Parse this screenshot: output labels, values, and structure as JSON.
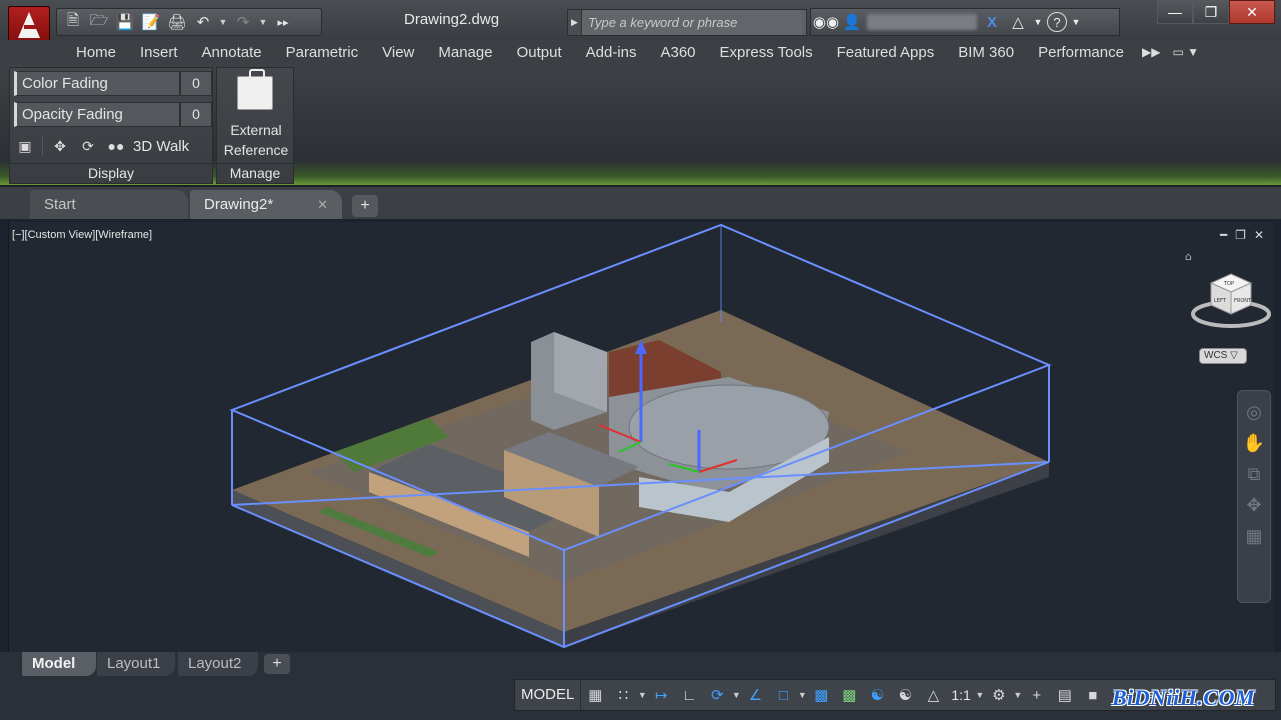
{
  "titlebar": {
    "doc_title": "Drawing2.dwg",
    "search_placeholder": "Type a keyword or phrase",
    "icons": [
      "new-icon",
      "open-icon",
      "save-icon",
      "saveas-icon",
      "plot-icon",
      "undo-icon",
      "redo-icon",
      "more-icon",
      "binoculars-icon",
      "user-icon",
      "exchange-icon",
      "a360-icon",
      "help-icon"
    ]
  },
  "ribbon_tabs": [
    "Home",
    "Insert",
    "Annotate",
    "Parametric",
    "View",
    "Manage",
    "Output",
    "Add-ins",
    "A360",
    "Express Tools",
    "Featured Apps",
    "BIM 360",
    "Performance"
  ],
  "ribbon": {
    "display": {
      "color_fading_label": "Color Fading",
      "color_fading_value": "0",
      "opacity_fading_label": "Opacity Fading",
      "opacity_fading_value": "0",
      "walk_label": "3D Walk",
      "title": "Display"
    },
    "manage": {
      "xref_line1": "External",
      "xref_line2": "Reference",
      "title": "Manage"
    }
  },
  "file_tabs": {
    "start": "Start",
    "drawing": "Drawing2*",
    "add": "+"
  },
  "viewport": {
    "label": "[−][Custom View][Wireframe]",
    "wcs": "WCS",
    "viewcube_top": "TOP",
    "viewcube_left": "LEFT",
    "viewcube_front": "FRONT"
  },
  "layout_tabs": [
    "Model",
    "Layout1",
    "Layout2"
  ],
  "statusbar": {
    "model": "MODEL",
    "scale": "1:1"
  },
  "watermark": "BiDNiiH.COM",
  "colors": {
    "accent_red": "#b21f1f",
    "selection_blue": "#5a86ff",
    "ribbon_green": "#6a9a3c"
  }
}
